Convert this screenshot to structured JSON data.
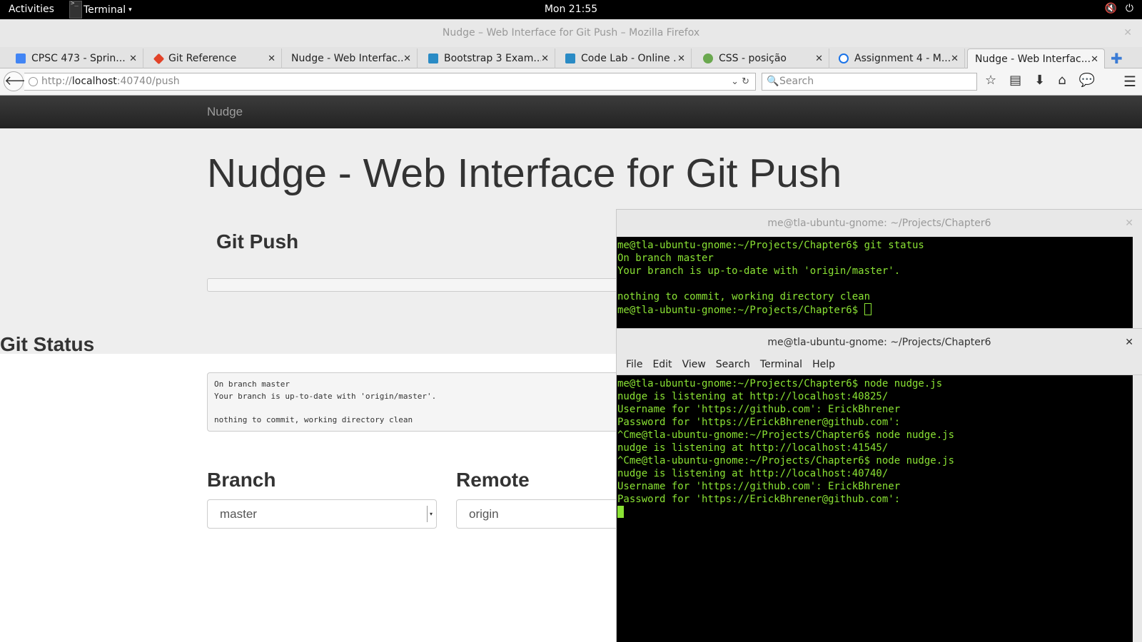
{
  "topbar": {
    "activities": "Activities",
    "app_menu": "Terminal",
    "caret": "▾",
    "clock": "Mon 21:55",
    "volume_icon": "🔇",
    "power_icon": "⏻"
  },
  "browser": {
    "window_title": "Nudge – Web Interface for Git Push – Mozilla Firefox",
    "close_glyph": "✕",
    "tabs": [
      {
        "label": "CPSC 473 - Sprin...",
        "color": "#4285f4"
      },
      {
        "label": "Git Reference",
        "color": "#e24329"
      },
      {
        "label": "Nudge - Web Interfac...",
        "color": ""
      },
      {
        "label": "Bootstrap 3 Exam...",
        "color": "#2a8bc5"
      },
      {
        "label": "Code Lab - Online ...",
        "color": "#2a8bc5"
      },
      {
        "label": "CSS - posição",
        "color": "#6aa84f"
      },
      {
        "label": "Assignment 4 - M...",
        "color": "#1a73e8"
      },
      {
        "label": "Nudge - Web Interfac...",
        "color": ""
      }
    ],
    "tab_close": "✕",
    "new_tab": "✚",
    "back_glyph": "🡐",
    "url_scheme": "http://",
    "url_host": "localhost",
    "url_rest": ":40740/push",
    "url_tools": "⌄ ↻",
    "search_placeholder": "Search",
    "search_icon": "🔍",
    "toolbar": {
      "bookmark": "☆",
      "library": "▤",
      "download": "⬇",
      "home": "⌂",
      "chat": "💬",
      "menu": "☰"
    }
  },
  "page": {
    "brand": "Nudge",
    "title": "Nudge - Web Interface for Git Push",
    "git_push_heading": "Git Push",
    "git_status_heading": "Git Status",
    "status_output": "On branch master\nYour branch is up-to-date with 'origin/master'.\n\nnothing to commit, working directory clean",
    "branch_label": "Branch",
    "branch_value": "master",
    "branch_arrow": "▾",
    "remote_label": "Remote",
    "remote_value": "origin"
  },
  "terminal_back": {
    "title": "me@tla-ubuntu-gnome: ~/Projects/Chapter6",
    "close": "✕",
    "output": "me@tla-ubuntu-gnome:~/Projects/Chapter6$ git status\nOn branch master\nYour branch is up-to-date with 'origin/master'.\n\nnothing to commit, working directory clean\n",
    "prompt": "me@tla-ubuntu-gnome:~/Projects/Chapter6$ "
  },
  "terminal_front": {
    "title": "me@tla-ubuntu-gnome: ~/Projects/Chapter6",
    "close": "✕",
    "menu": [
      "File",
      "Edit",
      "View",
      "Search",
      "Terminal",
      "Help"
    ],
    "output": "me@tla-ubuntu-gnome:~/Projects/Chapter6$ node nudge.js\nnudge is listening at http://localhost:40825/\nUsername for 'https://github.com': ErickBhrener\nPassword for 'https://ErickBhrener@github.com':\n^Cme@tla-ubuntu-gnome:~/Projects/Chapter6$ node nudge.js\nnudge is listening at http://localhost:41545/\n^Cme@tla-ubuntu-gnome:~/Projects/Chapter6$ node nudge.js\nnudge is listening at http://localhost:40740/\nUsername for 'https://github.com': ErickBhrener\nPassword for 'https://ErickBhrener@github.com':\n"
  },
  "colors": {
    "terminal_text": "#8ae234",
    "navbar_bg": "#222222",
    "jumbotron_bg": "#eeeeee"
  }
}
